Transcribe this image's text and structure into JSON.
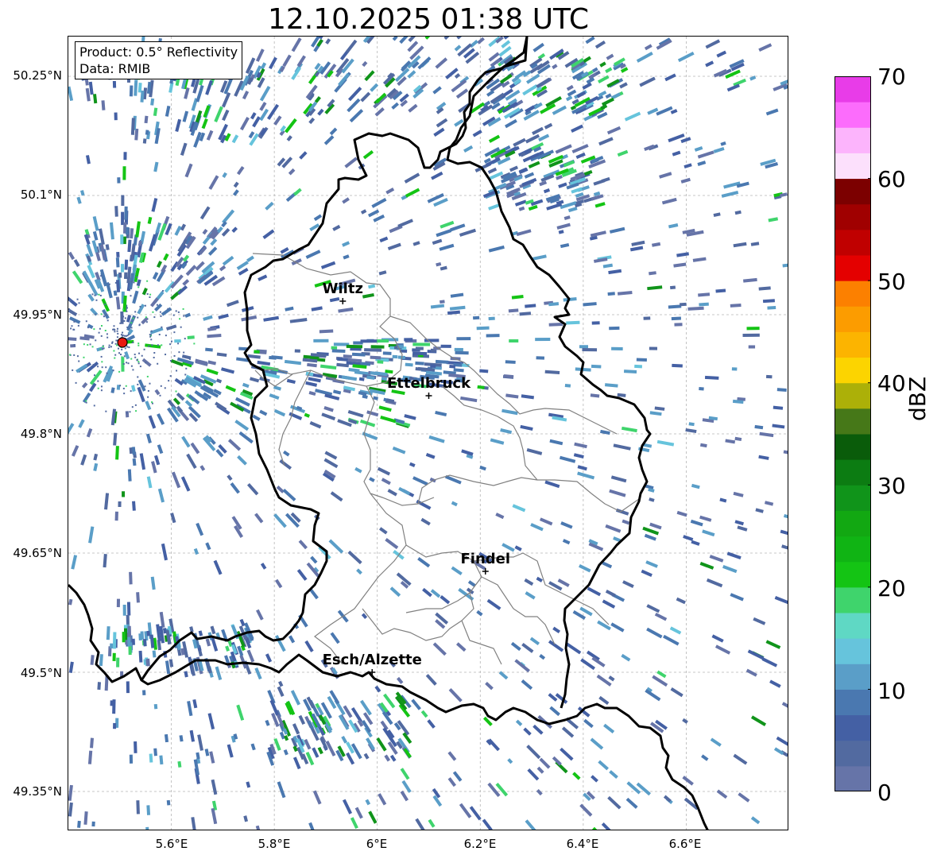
{
  "title": "12.10.2025 01:38 UTC",
  "info": {
    "product": "Product: 0.5° Reflectivity",
    "source": "Data: RMIB"
  },
  "axes": {
    "lat_ticks": [
      "50.25°N",
      "50.1°N",
      "49.95°N",
      "49.8°N",
      "49.65°N",
      "49.5°N",
      "49.35°N"
    ],
    "lon_ticks": [
      "5.6°E",
      "5.8°E",
      "6°E",
      "6.2°E",
      "6.4°E",
      "6.6°E"
    ]
  },
  "cities": [
    {
      "name": "Wiltz",
      "lon": 5.933,
      "lat": 49.967
    },
    {
      "name": "Ettelbruck",
      "lon": 6.1,
      "lat": 49.848
    },
    {
      "name": "Findel",
      "lon": 6.21,
      "lat": 49.627
    },
    {
      "name": "Esch/Alzette",
      "lon": 5.99,
      "lat": 49.5
    }
  ],
  "radar_site": {
    "lon": 5.505,
    "lat": 49.915,
    "color": "#e8190f"
  },
  "colorbar": {
    "label": "dBZ",
    "min": 0,
    "max": 70,
    "tick_labels": [
      "0",
      "10",
      "20",
      "30",
      "40",
      "50",
      "60",
      "70"
    ],
    "colors": [
      "#6674a8",
      "#526aa0",
      "#4460a4",
      "#4a78b0",
      "#5a9ec8",
      "#66c4dc",
      "#5fd8c4",
      "#3fd46c",
      "#14c414",
      "#10b414",
      "#12a812",
      "#10941a",
      "#0c7c12",
      "#0a5c0a",
      "#467818",
      "#acb008",
      "#fcd400",
      "#fcb400",
      "#fc9c00",
      "#fc8000",
      "#e40000",
      "#c00000",
      "#a00000",
      "#7c0000",
      "#fce0fc",
      "#fcb4fc",
      "#fc6cfc",
      "#e83ce8"
    ]
  },
  "map_extent": {
    "lon_min": 5.4,
    "lon_max": 6.8,
    "lat_min": 49.3,
    "lat_max": 50.3
  }
}
